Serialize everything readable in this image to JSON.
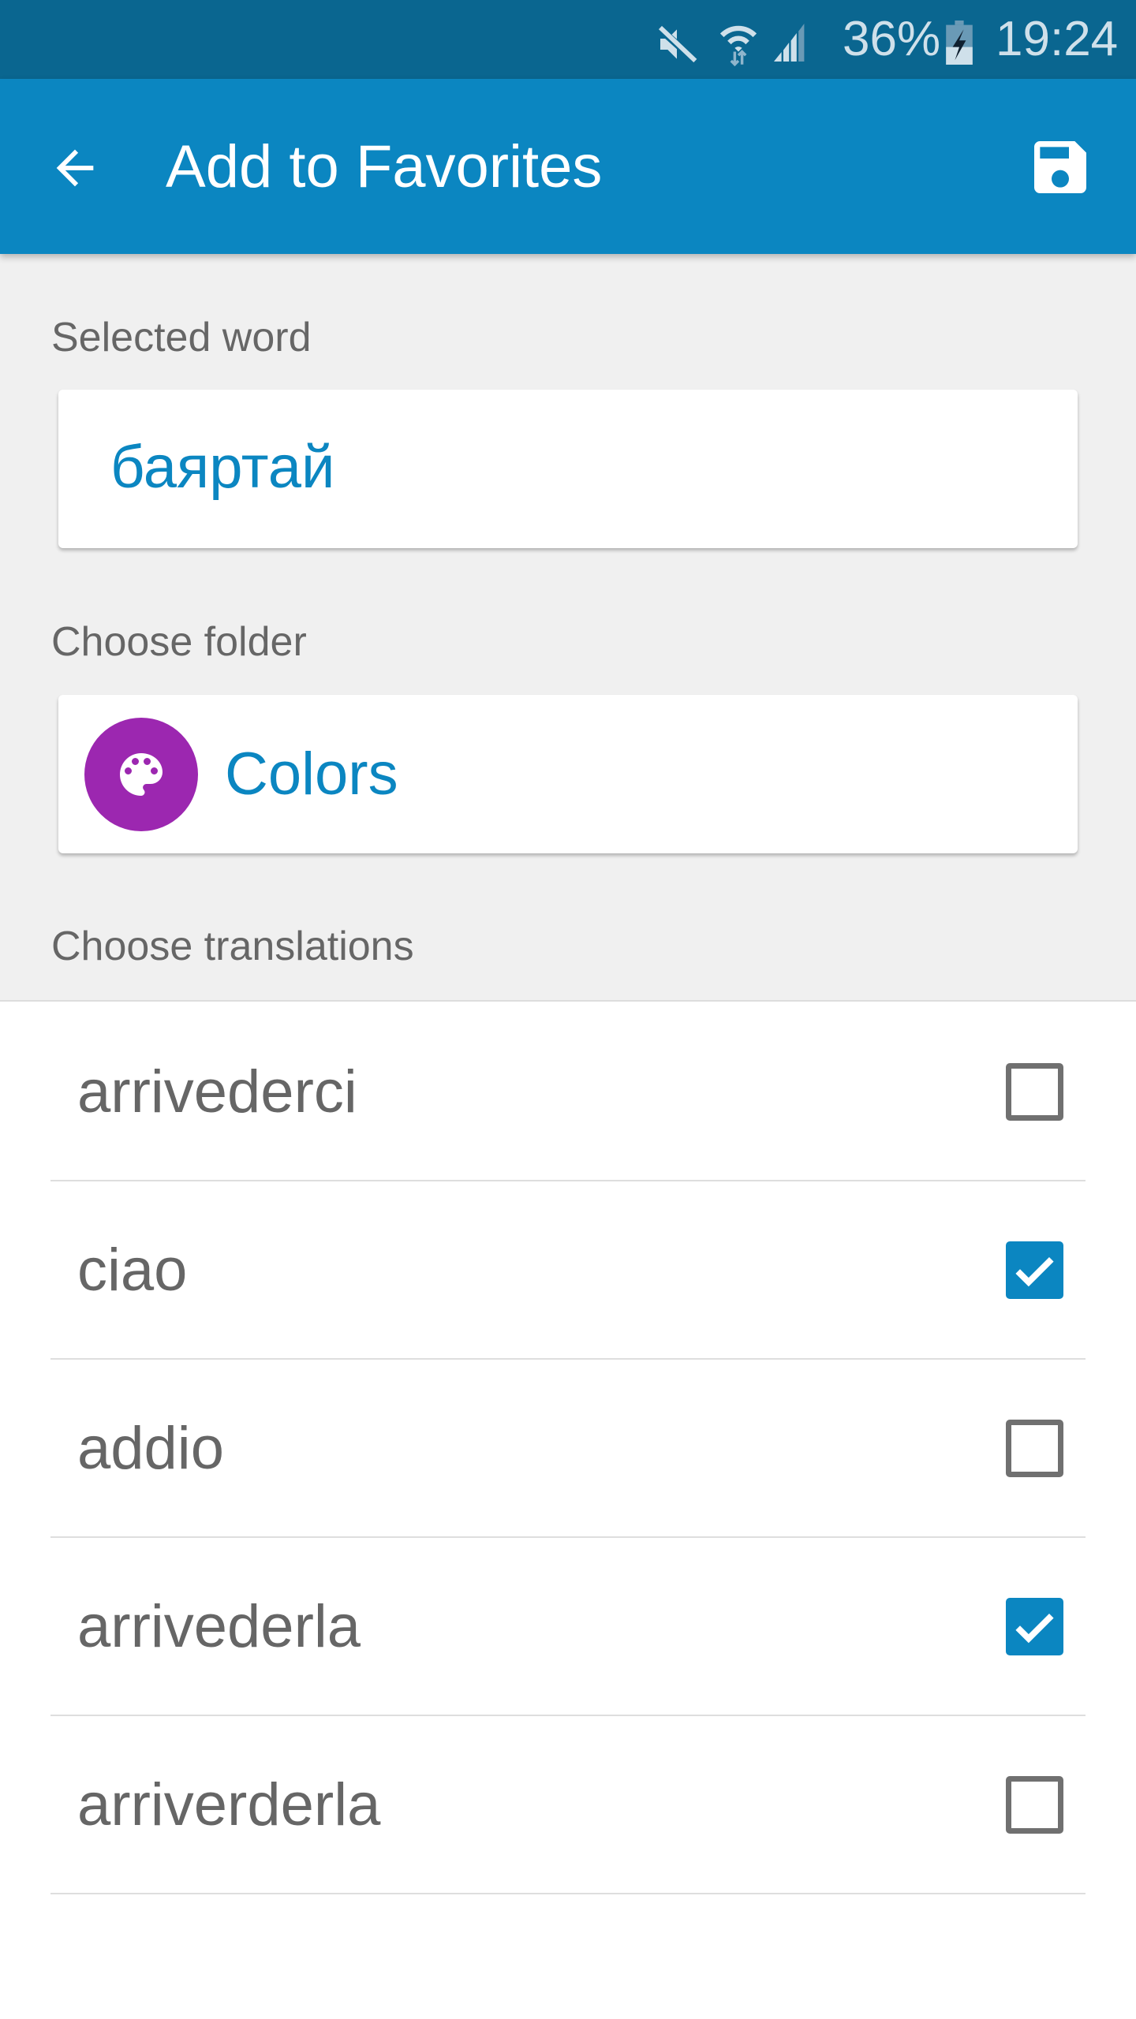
{
  "status_bar": {
    "battery": "36%",
    "time": "19:24",
    "icons": [
      "mute-icon",
      "wifi-icon",
      "signal-icon",
      "battery-charging-icon"
    ]
  },
  "app_bar": {
    "title": "Add to Favorites",
    "back_icon": "arrow-left-icon",
    "save_icon": "save-floppy-icon"
  },
  "selected_word": {
    "label": "Selected word",
    "value": "баяртай"
  },
  "folder": {
    "label": "Choose folder",
    "name": "Colors",
    "icon": "palette-icon",
    "icon_color": "#9c27b0"
  },
  "translations": {
    "label": "Choose translations",
    "items": [
      {
        "word": "arrivederci",
        "checked": false
      },
      {
        "word": "ciao",
        "checked": true
      },
      {
        "word": "addio",
        "checked": false
      },
      {
        "word": "arrivederla",
        "checked": true
      },
      {
        "word": "arriverderla",
        "checked": false
      }
    ]
  },
  "colors": {
    "accent": "#0b86c1",
    "status_bar": "#0a6690"
  }
}
